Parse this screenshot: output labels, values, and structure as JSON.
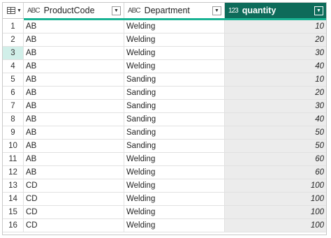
{
  "columns": [
    {
      "name": "ProductCode",
      "type_icon": "ABC"
    },
    {
      "name": "Department",
      "type_icon": "ABC"
    },
    {
      "name": "quantity",
      "type_icon": "123"
    }
  ],
  "selected_row": 3,
  "rows": [
    {
      "n": "1",
      "product": "AB",
      "dept": "Welding",
      "qty": "10"
    },
    {
      "n": "2",
      "product": "AB",
      "dept": "Welding",
      "qty": "20"
    },
    {
      "n": "3",
      "product": "AB",
      "dept": "Welding",
      "qty": "30"
    },
    {
      "n": "4",
      "product": "AB",
      "dept": "Welding",
      "qty": "40"
    },
    {
      "n": "5",
      "product": "AB",
      "dept": "Sanding",
      "qty": "10"
    },
    {
      "n": "6",
      "product": "AB",
      "dept": "Sanding",
      "qty": "20"
    },
    {
      "n": "7",
      "product": "AB",
      "dept": "Sanding",
      "qty": "30"
    },
    {
      "n": "8",
      "product": "AB",
      "dept": "Sanding",
      "qty": "40"
    },
    {
      "n": "9",
      "product": "AB",
      "dept": "Sanding",
      "qty": "50"
    },
    {
      "n": "10",
      "product": "AB",
      "dept": "Sanding",
      "qty": "50"
    },
    {
      "n": "11",
      "product": "AB",
      "dept": "Welding",
      "qty": "60"
    },
    {
      "n": "12",
      "product": "AB",
      "dept": "Welding",
      "qty": "60"
    },
    {
      "n": "13",
      "product": "CD",
      "dept": "Welding",
      "qty": "100"
    },
    {
      "n": "14",
      "product": "CD",
      "dept": "Welding",
      "qty": "100"
    },
    {
      "n": "15",
      "product": "CD",
      "dept": "Welding",
      "qty": "100"
    },
    {
      "n": "16",
      "product": "CD",
      "dept": "Welding",
      "qty": "100"
    }
  ]
}
